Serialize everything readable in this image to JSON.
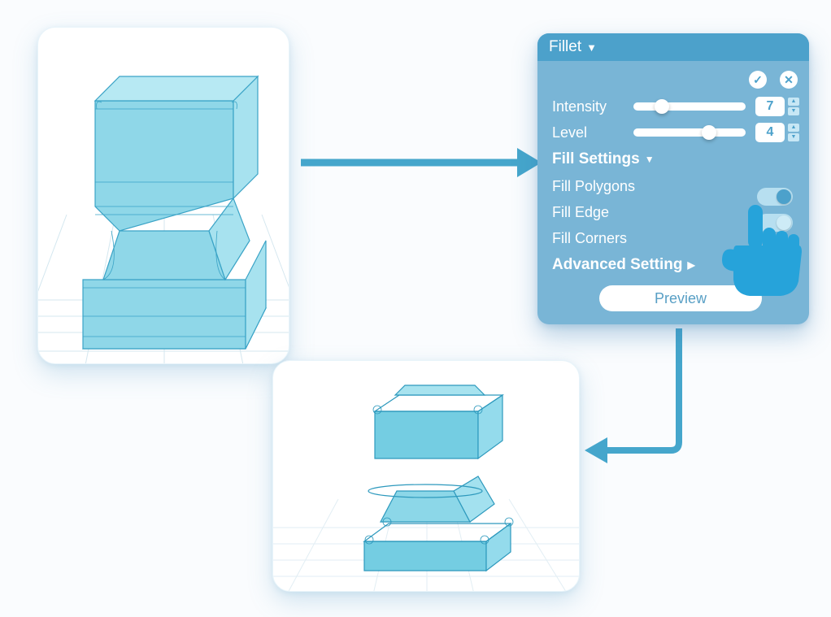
{
  "panel": {
    "title": "Fillet",
    "confirm_icon": "✓",
    "cancel_icon": "✕",
    "intensity": {
      "label": "Intensity",
      "value": "7"
    },
    "level": {
      "label": "Level",
      "value": "4"
    },
    "fill_settings_label": "Fill Settings",
    "fill_polygons_label": "Fill Polygons",
    "fill_edge_label": "Fill Edge",
    "fill_corners_label": "Fill Corners",
    "advanced_label": "Advanced Setting",
    "preview_label": "Preview"
  },
  "viewports": {
    "a_alt": "Filleted cube-hourglass with filled polygons on 3D grid",
    "b_alt": "Filleted cube-hourglass with open faces on 3D grid"
  },
  "flow": {
    "a_to_panel": "arrow from first viewport to Fillet panel",
    "panel_to_b": "arrow from Fillet panel down to second viewport"
  }
}
